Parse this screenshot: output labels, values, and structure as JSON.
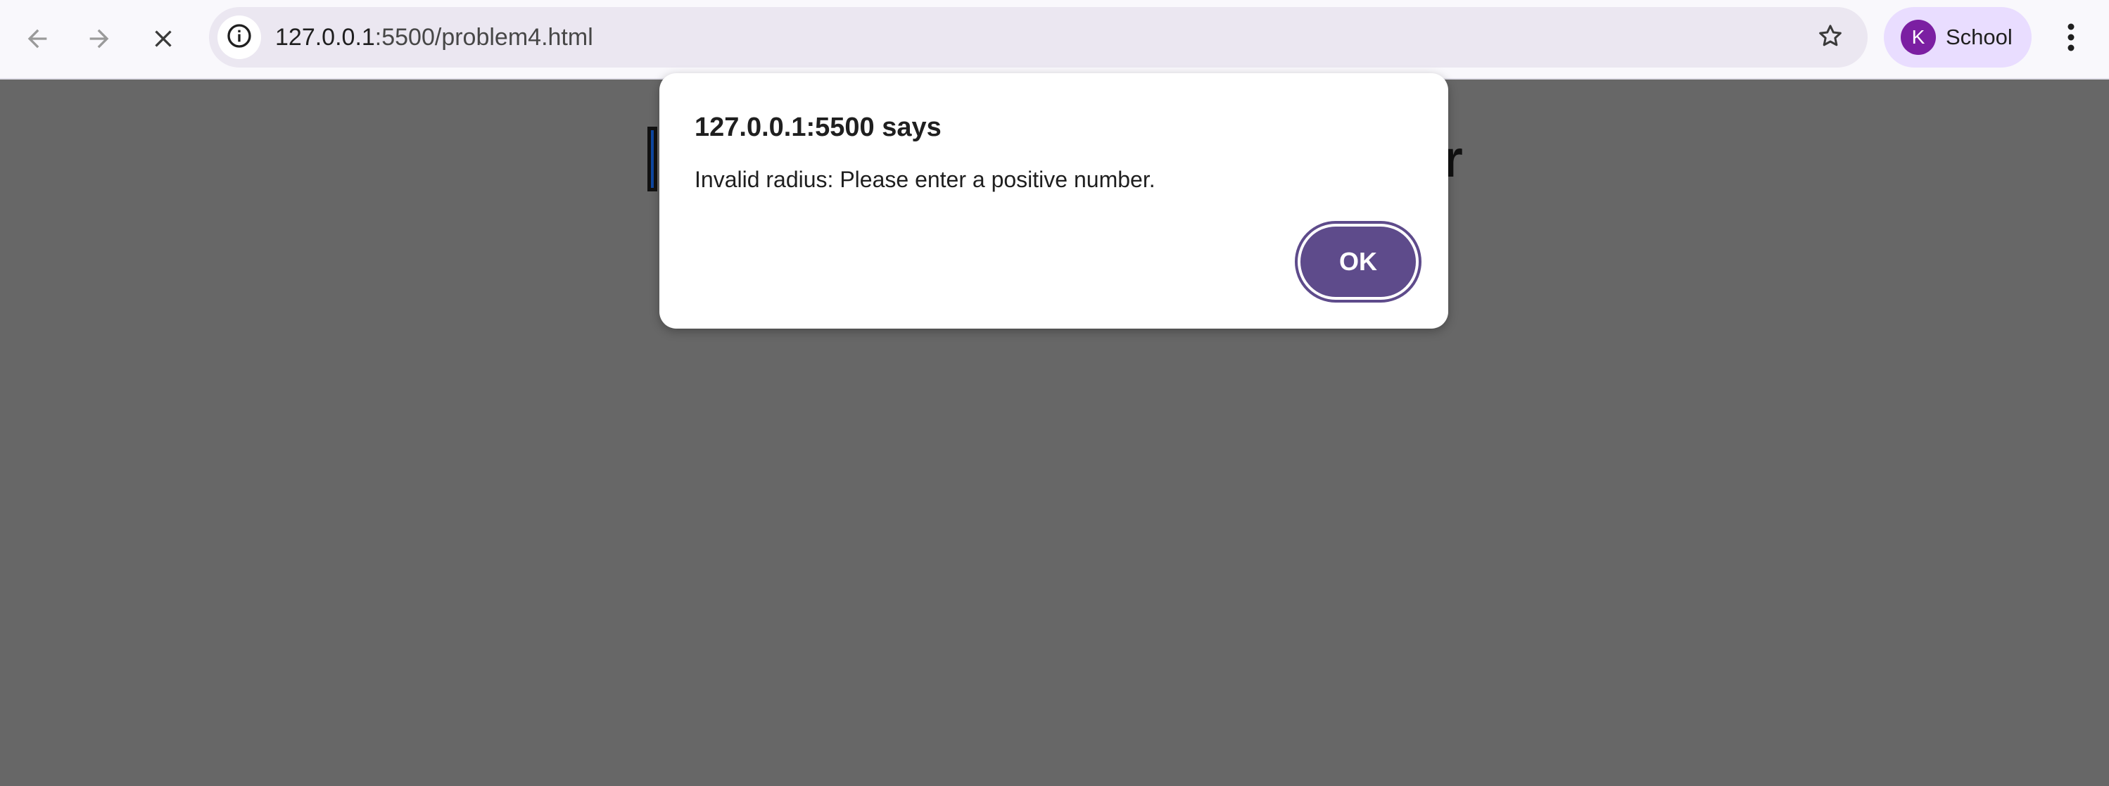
{
  "browser": {
    "url_host": "127.0.0.1",
    "url_path": ":5500/problem4.html",
    "profile_initial": "K",
    "profile_name": "School",
    "icons": {
      "back": "arrow-left-icon",
      "forward": "arrow-right-icon",
      "stop": "close-icon",
      "site_info": "info-icon",
      "bookmark": "star-icon",
      "menu": "more-vertical-icon"
    },
    "colors": {
      "toolbar": "#f9f8fc",
      "omnibox": "#ebe7f1",
      "profile_chip": "#e9ddff",
      "avatar": "#7b1fa2"
    }
  },
  "page": {
    "heading_trailing_char": "r",
    "overlay_color": "#676767"
  },
  "dialog": {
    "title": "127.0.0.1:5500 says",
    "message": "Invalid radius: Please enter a positive number.",
    "ok_label": "OK",
    "accent_color": "#5e4b8b"
  }
}
